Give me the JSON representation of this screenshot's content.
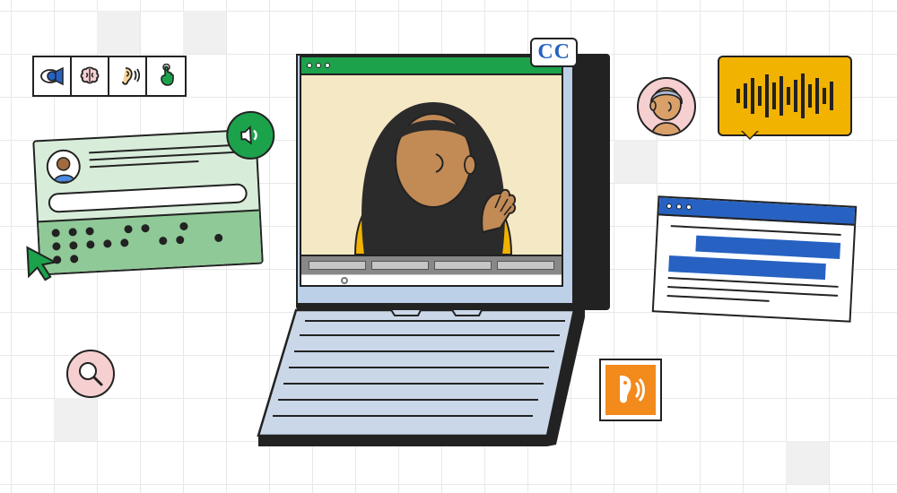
{
  "cc_label": "CC",
  "icons": {
    "eye": "eye-icon",
    "brain": "brain-icon",
    "ear": "ear-icon",
    "touch": "touch-icon",
    "speaker": "speaker-icon",
    "cursor": "cursor-icon",
    "magnifier": "magnifier-icon",
    "voice": "voice-icon",
    "waveform": "waveform-icon"
  },
  "colors": {
    "green": "#1ca24b",
    "blue": "#2762c2",
    "yellow": "#f2b200",
    "orange": "#f28a1c",
    "pink": "#f6cfd1",
    "light_green": "#d7edd9",
    "light_blue": "#bcd0e8",
    "cream": "#f5e8c4"
  }
}
